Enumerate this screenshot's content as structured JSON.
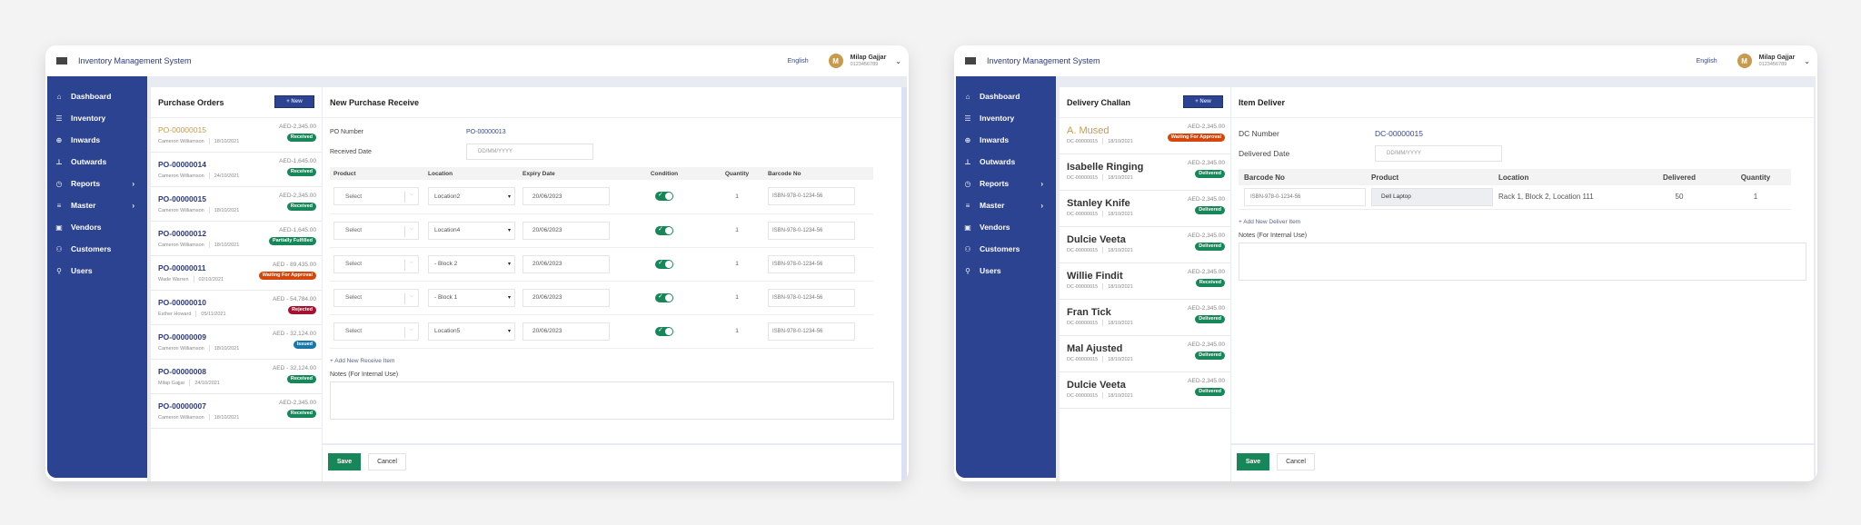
{
  "app_title": "Inventory Management System",
  "language": "English",
  "user": {
    "initial": "M",
    "name": "Milap Gajjar",
    "phone": "0123456789"
  },
  "sidebar": {
    "items": [
      {
        "label": "Dashboard",
        "icon": "home-icon",
        "glyph": "⌂",
        "has_submenu": false
      },
      {
        "label": "Inventory",
        "icon": "database-icon",
        "glyph": "☰",
        "has_submenu": false
      },
      {
        "label": "Inwards",
        "icon": "inwards-icon",
        "glyph": "⊕",
        "has_submenu": false
      },
      {
        "label": "Outwards",
        "icon": "outwards-icon",
        "glyph": "⊥",
        "has_submenu": false
      },
      {
        "label": "Reports",
        "icon": "clock-icon",
        "glyph": "◷",
        "has_submenu": true
      },
      {
        "label": "Master",
        "icon": "list-icon",
        "glyph": "≡",
        "has_submenu": true
      },
      {
        "label": "Vendors",
        "icon": "store-icon",
        "glyph": "▣",
        "has_submenu": false
      },
      {
        "label": "Customers",
        "icon": "users-icon",
        "glyph": "⚇",
        "has_submenu": false
      },
      {
        "label": "Users",
        "icon": "user-icon",
        "glyph": "⚲",
        "has_submenu": false
      }
    ],
    "submenu_arrow": "›"
  },
  "purchase": {
    "list_title": "Purchase Orders",
    "new_label": "+  New",
    "orders": [
      {
        "id": "PO-00000015",
        "person": "Cameron Williamson",
        "date": "18/10/2021",
        "amount": "AED-2,345.00",
        "status": "Received",
        "status_class": "received",
        "active": true
      },
      {
        "id": "PO-00000014",
        "person": "Cameron Williamson",
        "date": "24/10/2021",
        "amount": "AED-1,645.00",
        "status": "Received",
        "status_class": "received",
        "active": false
      },
      {
        "id": "PO-00000015",
        "person": "Cameron Williamson",
        "date": "18/10/2021",
        "amount": "AED-2,345.00",
        "status": "Received",
        "status_class": "received",
        "active": false
      },
      {
        "id": "PO-00000012",
        "person": "Cameron Williamson",
        "date": "18/10/2021",
        "amount": "AED-1,645.00",
        "status": "Partially Fulfilled",
        "status_class": "partial",
        "active": false
      },
      {
        "id": "PO-00000011",
        "person": "Wade Warren",
        "date": "02/10/2021",
        "amount": "AED - 89,435.00",
        "status": "Waiting For Approval",
        "status_class": "waiting",
        "active": false
      },
      {
        "id": "PO-00000010",
        "person": "Esther Howard",
        "date": "05/11/2021",
        "amount": "AED - 54,784.00",
        "status": "Rejected",
        "status_class": "rejected",
        "active": false
      },
      {
        "id": "PO-00000009",
        "person": "Cameron Williamson",
        "date": "18/10/2021",
        "amount": "AED - 32,124.00",
        "status": "Issued",
        "status_class": "issued",
        "active": false
      },
      {
        "id": "PO-00000008",
        "person": "Milap Gajjar",
        "date": "24/10/2021",
        "amount": "AED - 32,124.00",
        "status": "Received",
        "status_class": "received",
        "active": false
      },
      {
        "id": "PO-00000007",
        "person": "Cameron Williamson",
        "date": "18/10/2021",
        "amount": "AED-2,345.00",
        "status": "Received",
        "status_class": "received",
        "active": false
      }
    ],
    "form": {
      "title": "New Purchase Receive",
      "po_number_label": "PO Number",
      "po_number": "PO-00000013",
      "received_date_label": "Received Date",
      "received_date_placeholder": "DD/MM/YYYY",
      "columns": [
        "Product",
        "Location",
        "Expiry Date",
        "Condition",
        "Quantity",
        "Barcode No"
      ],
      "rows": [
        {
          "product": "Select",
          "location": "Location2",
          "expiry": "20/06/2023",
          "condition": true,
          "quantity": "1",
          "barcode": "ISBN-978-0-1234-56"
        },
        {
          "product": "Select",
          "location": "Location4",
          "expiry": "20/06/2023",
          "condition": true,
          "quantity": "1",
          "barcode": "ISBN-978-0-1234-56"
        },
        {
          "product": "Select",
          "location": "- Block 2",
          "expiry": "20/06/2023",
          "condition": true,
          "quantity": "1",
          "barcode": "ISBN-978-0-1234-56"
        },
        {
          "product": "Select",
          "location": "- Block 1",
          "expiry": "20/06/2023",
          "condition": true,
          "quantity": "1",
          "barcode": "ISBN-978-0-1234-56"
        },
        {
          "product": "Select",
          "location": "Location5",
          "expiry": "20/06/2023",
          "condition": true,
          "quantity": "1",
          "barcode": "ISBN-978-0-1234-56"
        }
      ],
      "add_item_label": "+  Add New Receive Item",
      "notes_label": "Notes (For Internal Use)",
      "notes_value": "",
      "save_label": "Save",
      "cancel_label": "Cancel"
    }
  },
  "delivery": {
    "list_title": "Delivery Challan",
    "new_label": "+  New",
    "challans": [
      {
        "name": "A. Mused",
        "dc": "DC-00000015",
        "date": "18/10/2021",
        "amount": "AED-2,345.00",
        "status": "Waiting For Approval",
        "status_class": "waiting",
        "active": true
      },
      {
        "name": "Isabelle Ringing",
        "dc": "DC-00000015",
        "date": "18/10/2021",
        "amount": "AED-2,345.00",
        "status": "Delivered",
        "status_class": "delivered",
        "active": false
      },
      {
        "name": "Stanley Knife",
        "dc": "DC-00000015",
        "date": "18/10/2021",
        "amount": "AED-2,345.00",
        "status": "Delivered",
        "status_class": "delivered",
        "active": false
      },
      {
        "name": "Dulcie Veeta",
        "dc": "DC-00000015",
        "date": "18/10/2021",
        "amount": "AED-2,345.00",
        "status": "Delivered",
        "status_class": "delivered",
        "active": false
      },
      {
        "name": "Willie Findit",
        "dc": "DC-00000015",
        "date": "18/10/2021",
        "amount": "AED-2,345.00",
        "status": "Received",
        "status_class": "received",
        "active": false
      },
      {
        "name": "Fran Tick",
        "dc": "DC-00000015",
        "date": "18/10/2021",
        "amount": "AED-2,345.00",
        "status": "Delivered",
        "status_class": "delivered",
        "active": false
      },
      {
        "name": "Mal Ajusted",
        "dc": "DC-00000015",
        "date": "18/10/2021",
        "amount": "AED-2,345.00",
        "status": "Delivered",
        "status_class": "delivered",
        "active": false
      },
      {
        "name": "Dulcie Veeta",
        "dc": "DC-00000015",
        "date": "18/10/2021",
        "amount": "AED-2,345.00",
        "status": "Delivered",
        "status_class": "delivered",
        "active": false
      }
    ],
    "form": {
      "title": "Item Deliver",
      "dc_number_label": "DC Number",
      "dc_number": "DC-00000015",
      "delivered_date_label": "Delivered Date",
      "delivered_date_placeholder": "DD/MM/YYYY",
      "columns": [
        "Barcode No",
        "Product",
        "Location",
        "Delivered",
        "Quantity"
      ],
      "rows": [
        {
          "barcode": "ISBN-978-0-1234-56",
          "product": "Dell Laptop",
          "location": "Rack 1, Block 2, Location 111",
          "delivered": "50",
          "quantity": "1"
        }
      ],
      "add_item_label": "+  Add New Deliver Item",
      "notes_label": "Notes (For Internal Use)",
      "notes_value": "",
      "save_label": "Save",
      "cancel_label": "Cancel"
    }
  },
  "colors": {
    "brand": "#2c4391",
    "accent": "#c89a4e",
    "success": "#17875a",
    "warning": "#d4460c",
    "danger": "#a5122f",
    "info": "#1b76a8"
  }
}
